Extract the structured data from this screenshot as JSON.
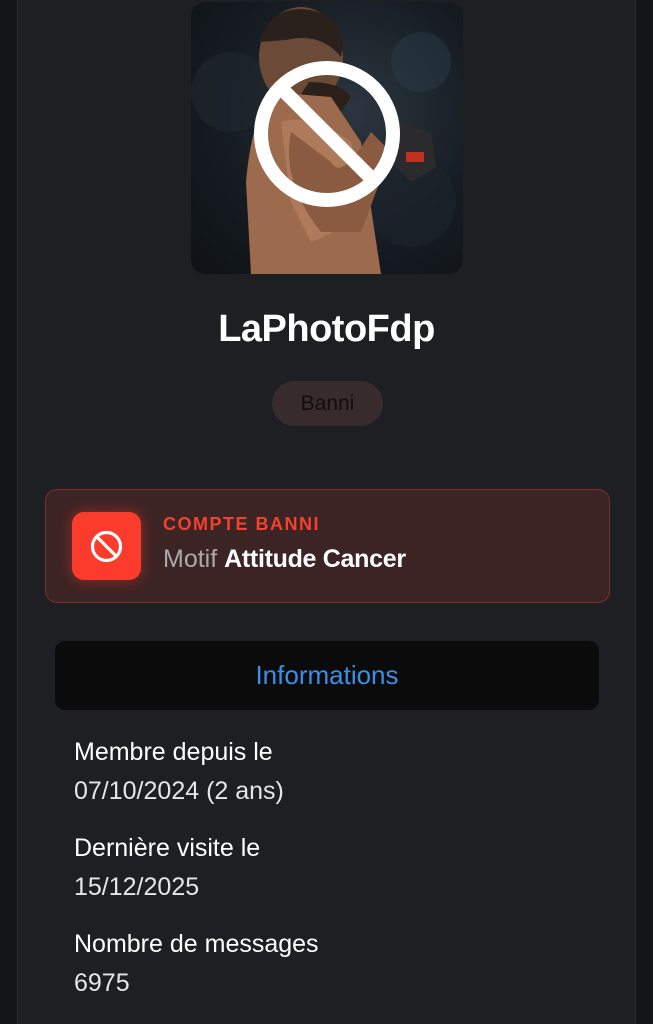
{
  "profile": {
    "username": "LaPhotoFdp",
    "role_badge": "Banni"
  },
  "ban": {
    "title": "COMPTE BANNI",
    "reason_label": "Motif",
    "reason_value": "Attitude Cancer",
    "icon": "ban-icon",
    "accent_color": "#fb3b2b"
  },
  "info": {
    "header": "Informations",
    "header_color": "#3d8ee6",
    "items": [
      {
        "label": "Membre depuis le",
        "value": "07/10/2024 (2 ans)"
      },
      {
        "label": "Dernière visite le",
        "value": "15/12/2025"
      },
      {
        "label": "Nombre de messages",
        "value": "6975"
      }
    ]
  }
}
